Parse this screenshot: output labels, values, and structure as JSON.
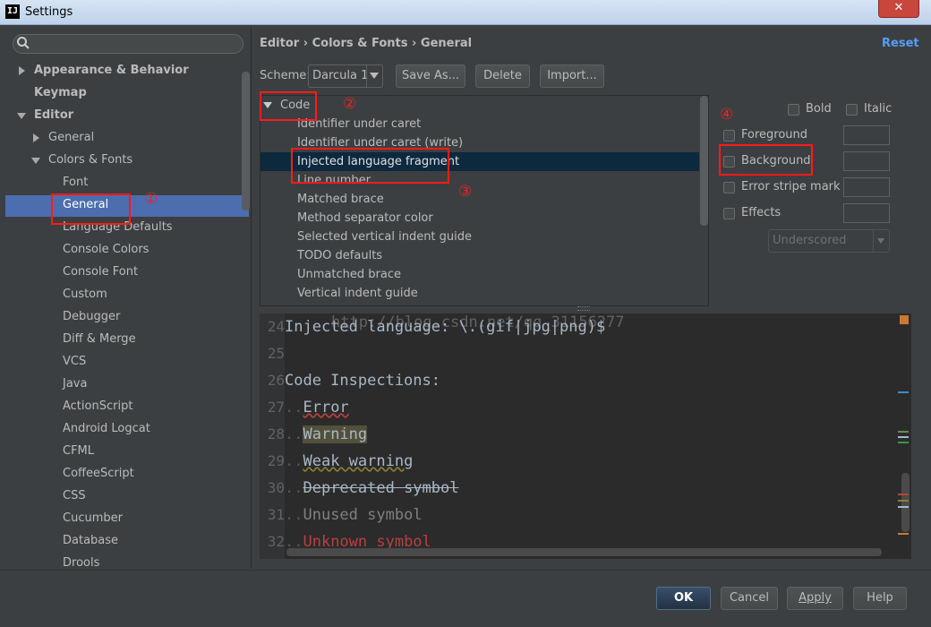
{
  "window": {
    "title": "Settings",
    "app_icon": "IJ",
    "close_label": "✕"
  },
  "sidebar": {
    "search_placeholder": "",
    "items": [
      {
        "label": "Appearance & Behavior"
      },
      {
        "label": "Keymap"
      },
      {
        "label": "Editor"
      },
      {
        "label": "General"
      },
      {
        "label": "Colors & Fonts"
      },
      {
        "label": "Font"
      },
      {
        "label": "General"
      },
      {
        "label": "Language Defaults"
      },
      {
        "label": "Console Colors"
      },
      {
        "label": "Console Font"
      },
      {
        "label": "Custom"
      },
      {
        "label": "Debugger"
      },
      {
        "label": "Diff & Merge"
      },
      {
        "label": "VCS"
      },
      {
        "label": "Java"
      },
      {
        "label": "ActionScript"
      },
      {
        "label": "Android Logcat"
      },
      {
        "label": "CFML"
      },
      {
        "label": "CoffeeScript"
      },
      {
        "label": "CSS"
      },
      {
        "label": "Cucumber"
      },
      {
        "label": "Database"
      },
      {
        "label": "Drools"
      }
    ]
  },
  "header": {
    "breadcrumb": "Editor › Colors & Fonts › General",
    "reset": "Reset"
  },
  "scheme": {
    "label": "Scheme:",
    "value": "Darcula 1",
    "save_as": "Save As...",
    "delete": "Delete",
    "import": "Import..."
  },
  "element_list": {
    "group": "Code",
    "items": [
      "Identifier under caret",
      "Identifier under caret (write)",
      "Injected language fragment",
      "Line number",
      "Matched brace",
      "Method separator color",
      "Selected vertical indent guide",
      "TODO defaults",
      "Unmatched brace",
      "Vertical indent guide"
    ],
    "selected": "Injected language fragment"
  },
  "options": {
    "bold": "Bold",
    "italic": "Italic",
    "foreground": "Foreground",
    "background": "Background",
    "error_stripe": "Error stripe mark",
    "effects": "Effects",
    "effect_type": "Underscored"
  },
  "preview": {
    "watermark": "http://blog.csdn.net/qq_31156277",
    "lines": [
      {
        "num": "24",
        "text": "Injected language: \\.(gif|jpg|png)$"
      },
      {
        "num": "25",
        "text": ""
      },
      {
        "num": "26",
        "text": "Code Inspections:"
      },
      {
        "num": "27",
        "dots": "..",
        "text": "Error"
      },
      {
        "num": "28",
        "dots": "..",
        "text": "Warning"
      },
      {
        "num": "29",
        "dots": "..",
        "text": "Weak warning"
      },
      {
        "num": "30",
        "dots": "..",
        "text": "Deprecated symbol"
      },
      {
        "num": "31",
        "dots": "..",
        "text": "Unused symbol"
      },
      {
        "num": "32",
        "dots": "..",
        "text": "Unknown symbol"
      }
    ]
  },
  "footer": {
    "ok": "OK",
    "cancel": "Cancel",
    "apply": "Apply",
    "help": "Help"
  },
  "annotations": [
    "①",
    "②",
    "③",
    "④"
  ],
  "colors": {
    "selection": "#4b6eaf",
    "list_selection": "#0d293e",
    "annotation": "#ff1a1a",
    "link": "#589df6"
  }
}
